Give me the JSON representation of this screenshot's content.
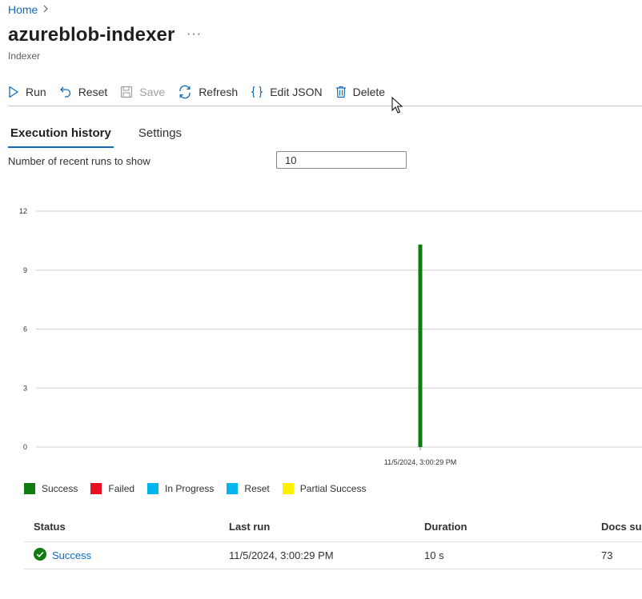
{
  "breadcrumb": {
    "home": "Home"
  },
  "header": {
    "title": "azureblob-indexer",
    "more": "···",
    "subtitle": "Indexer"
  },
  "toolbar": {
    "run": "Run",
    "reset": "Reset",
    "save": "Save",
    "refresh": "Refresh",
    "edit_json": "Edit JSON",
    "delete": "Delete"
  },
  "tabs": {
    "execution_history": "Execution history",
    "settings": "Settings"
  },
  "runs": {
    "label": "Number of recent runs to show",
    "value": "10"
  },
  "chart_data": {
    "type": "bar",
    "categories": [
      "11/5/2024, 3:00:29 PM"
    ],
    "series": [
      {
        "name": "Success",
        "color": "#107c10",
        "values": [
          10.3
        ]
      }
    ],
    "yticks": [
      0,
      3,
      6,
      9,
      12
    ],
    "ylim": [
      0,
      12
    ],
    "grid": true,
    "legend_position": "bottom-left"
  },
  "legend": [
    {
      "label": "Success",
      "color": "#107c10"
    },
    {
      "label": "Failed",
      "color": "#e81123"
    },
    {
      "label": "In Progress",
      "color": "#00b4f0"
    },
    {
      "label": "Reset",
      "color": "#00b4f0"
    },
    {
      "label": "Partial Success",
      "color": "#fff100"
    }
  ],
  "table": {
    "headers": {
      "status": "Status",
      "last_run": "Last run",
      "duration": "Duration",
      "docs": "Docs succ"
    },
    "rows": [
      {
        "status": "Success",
        "last_run": "11/5/2024, 3:00:29 PM",
        "duration": "10 s",
        "docs": "73"
      }
    ]
  },
  "colors": {
    "accent": "#0f6cbd",
    "success": "#107c10"
  }
}
